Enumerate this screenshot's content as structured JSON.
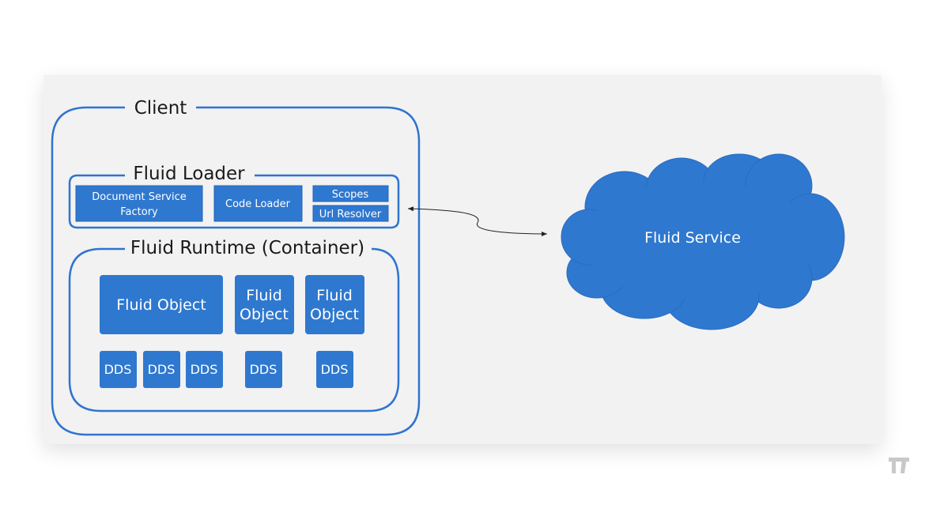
{
  "colors": {
    "box": "#2f78cf",
    "outline": "#2f74d0",
    "panel": "#f2f2f2",
    "text_dark": "#1a1a1a"
  },
  "client": {
    "title": "Client"
  },
  "loader": {
    "title": "Fluid Loader",
    "doc_factory": [
      "Document Service",
      "Factory"
    ],
    "code_loader": "Code Loader",
    "scopes": "Scopes",
    "url_resolver": "Url Resolver"
  },
  "runtime": {
    "title": "Fluid Runtime (Container)",
    "objects": [
      {
        "lines": [
          "Fluid Object"
        ]
      },
      {
        "lines": [
          "Fluid",
          "Object"
        ]
      },
      {
        "lines": [
          "Fluid",
          "Object"
        ]
      }
    ],
    "dds": [
      "DDS",
      "DDS",
      "DDS",
      "DDS",
      "DDS"
    ]
  },
  "service": {
    "title": "Fluid Service"
  },
  "watermark": {
    "logo": "TT"
  }
}
